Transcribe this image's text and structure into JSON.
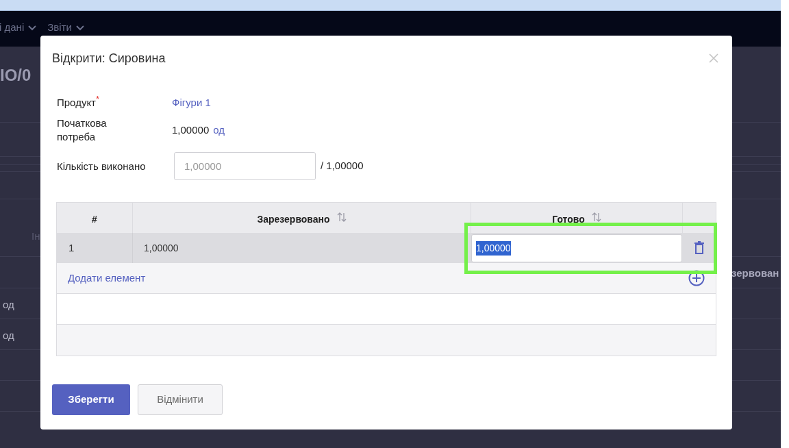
{
  "navbar": {
    "menus": [
      {
        "label": "і дані"
      },
      {
        "label": "Звіти"
      }
    ]
  },
  "background": {
    "heading": "IO/0",
    "tab_label": "Ін",
    "units": [
      "од",
      "од"
    ],
    "column_header": "зервован"
  },
  "dialog": {
    "title": "Відкрити: Сировина",
    "fields": [
      {
        "kind": "link",
        "label": "Продукт",
        "required_mark": "*",
        "value": "Фігури 1"
      },
      {
        "kind": "quantity",
        "label": "Початкова потреба",
        "value": "1,00000",
        "unit": "од"
      },
      {
        "kind": "input",
        "label": "Кількість виконано",
        "placeholder": "1,00000",
        "total": "/ 1,00000"
      }
    ],
    "table": {
      "columns": [
        {
          "label": "#",
          "sortable": false
        },
        {
          "label": "Зарезервовано",
          "sortable": true
        },
        {
          "label": "Готово",
          "sortable": true
        }
      ],
      "rows": [
        {
          "number": "1",
          "reserved": "1,00000",
          "ready": "1,00000",
          "ready_selected": true
        }
      ],
      "add_label": "Додати елемент"
    },
    "highlight": {
      "kind": "ready-field"
    },
    "buttons": [
      {
        "kind": "primary",
        "label": "Зберегти"
      },
      {
        "kind": "secondary",
        "label": "Відмінити"
      }
    ]
  }
}
